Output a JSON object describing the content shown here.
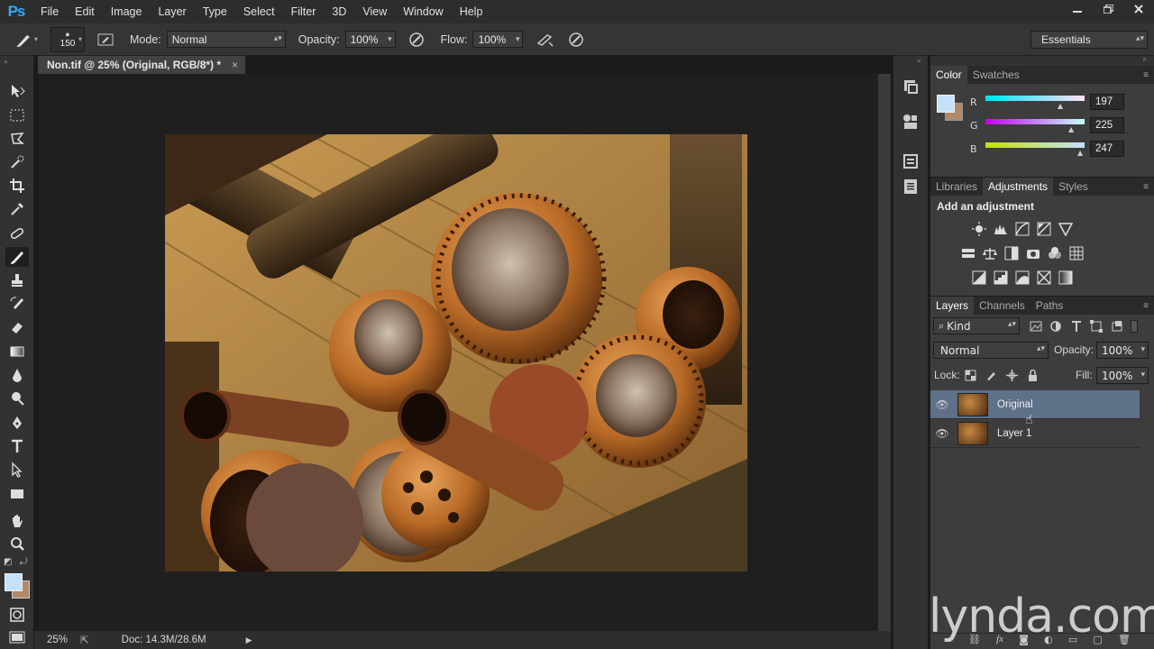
{
  "app": {
    "logo": "Ps"
  },
  "menu": [
    "File",
    "Edit",
    "Image",
    "Layer",
    "Type",
    "Select",
    "Filter",
    "3D",
    "View",
    "Window",
    "Help"
  ],
  "options": {
    "brush_size": "150",
    "mode_label": "Mode:",
    "mode_value": "Normal",
    "opacity_label": "Opacity:",
    "opacity_value": "100%",
    "flow_label": "Flow:",
    "flow_value": "100%",
    "workspace": "Essentials"
  },
  "document": {
    "tab_title": "Non.tif @ 25% (Original, RGB/8*) *",
    "close": "×",
    "zoom": "25%",
    "doc_size": "Doc: 14.3M/28.6M"
  },
  "color_panel": {
    "tabs": [
      "Color",
      "Swatches"
    ],
    "r_label": "R",
    "r_value": "197",
    "g_label": "G",
    "g_value": "225",
    "b_label": "B",
    "b_value": "247",
    "foreground": "#c5e1f7",
    "background": "#b08a6a"
  },
  "adjustments_panel": {
    "tabs": [
      "Libraries",
      "Adjustments",
      "Styles"
    ],
    "heading": "Add an adjustment"
  },
  "layers_panel": {
    "tabs": [
      "Layers",
      "Channels",
      "Paths"
    ],
    "filter_kind": "Kind",
    "blend_mode": "Normal",
    "opacity_label": "Opacity:",
    "opacity_value": "100%",
    "lock_label": "Lock:",
    "fill_label": "Fill:",
    "fill_value": "100%",
    "layers": [
      {
        "name": "Original",
        "selected": true
      },
      {
        "name": "Layer 1",
        "selected": false
      }
    ]
  },
  "watermark": "lynda.com"
}
